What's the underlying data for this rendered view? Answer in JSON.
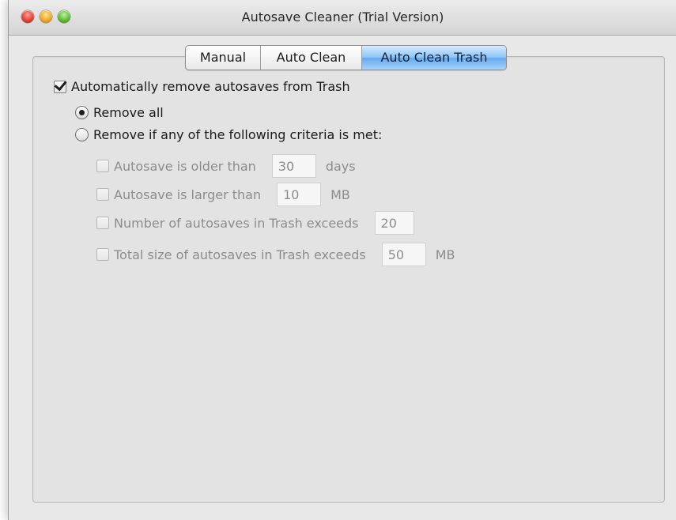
{
  "window": {
    "title": "Autosave Cleaner (Trial Version)"
  },
  "tabs": [
    {
      "label": "Manual",
      "active": false
    },
    {
      "label": "Auto Clean",
      "active": false
    },
    {
      "label": "Auto Clean Trash",
      "active": true
    }
  ],
  "options": {
    "auto_remove_label": "Automatically remove autosaves from Trash",
    "auto_remove_checked": true,
    "remove_all_label": "Remove all",
    "remove_all_selected": true,
    "remove_if_label": "Remove if any of the following criteria is met:",
    "remove_if_selected": false
  },
  "criteria": [
    {
      "label": "Autosave is older than",
      "value": "30",
      "unit": "days",
      "checked": false,
      "enabled": false
    },
    {
      "label": "Autosave is larger than",
      "value": "10",
      "unit": "MB",
      "checked": false,
      "enabled": false
    },
    {
      "label": "Number of autosaves in Trash exceeds",
      "value": "20",
      "unit": "",
      "checked": false,
      "enabled": false
    },
    {
      "label": "Total size of autosaves in Trash exceeds",
      "value": "50",
      "unit": "MB",
      "checked": false,
      "enabled": false
    }
  ],
  "colors": {
    "active_tab": "#63a9ee",
    "window_bg": "#e8e8e8",
    "close": "#e0443a",
    "minimize": "#f0a72a",
    "zoom": "#5fbf3a"
  }
}
